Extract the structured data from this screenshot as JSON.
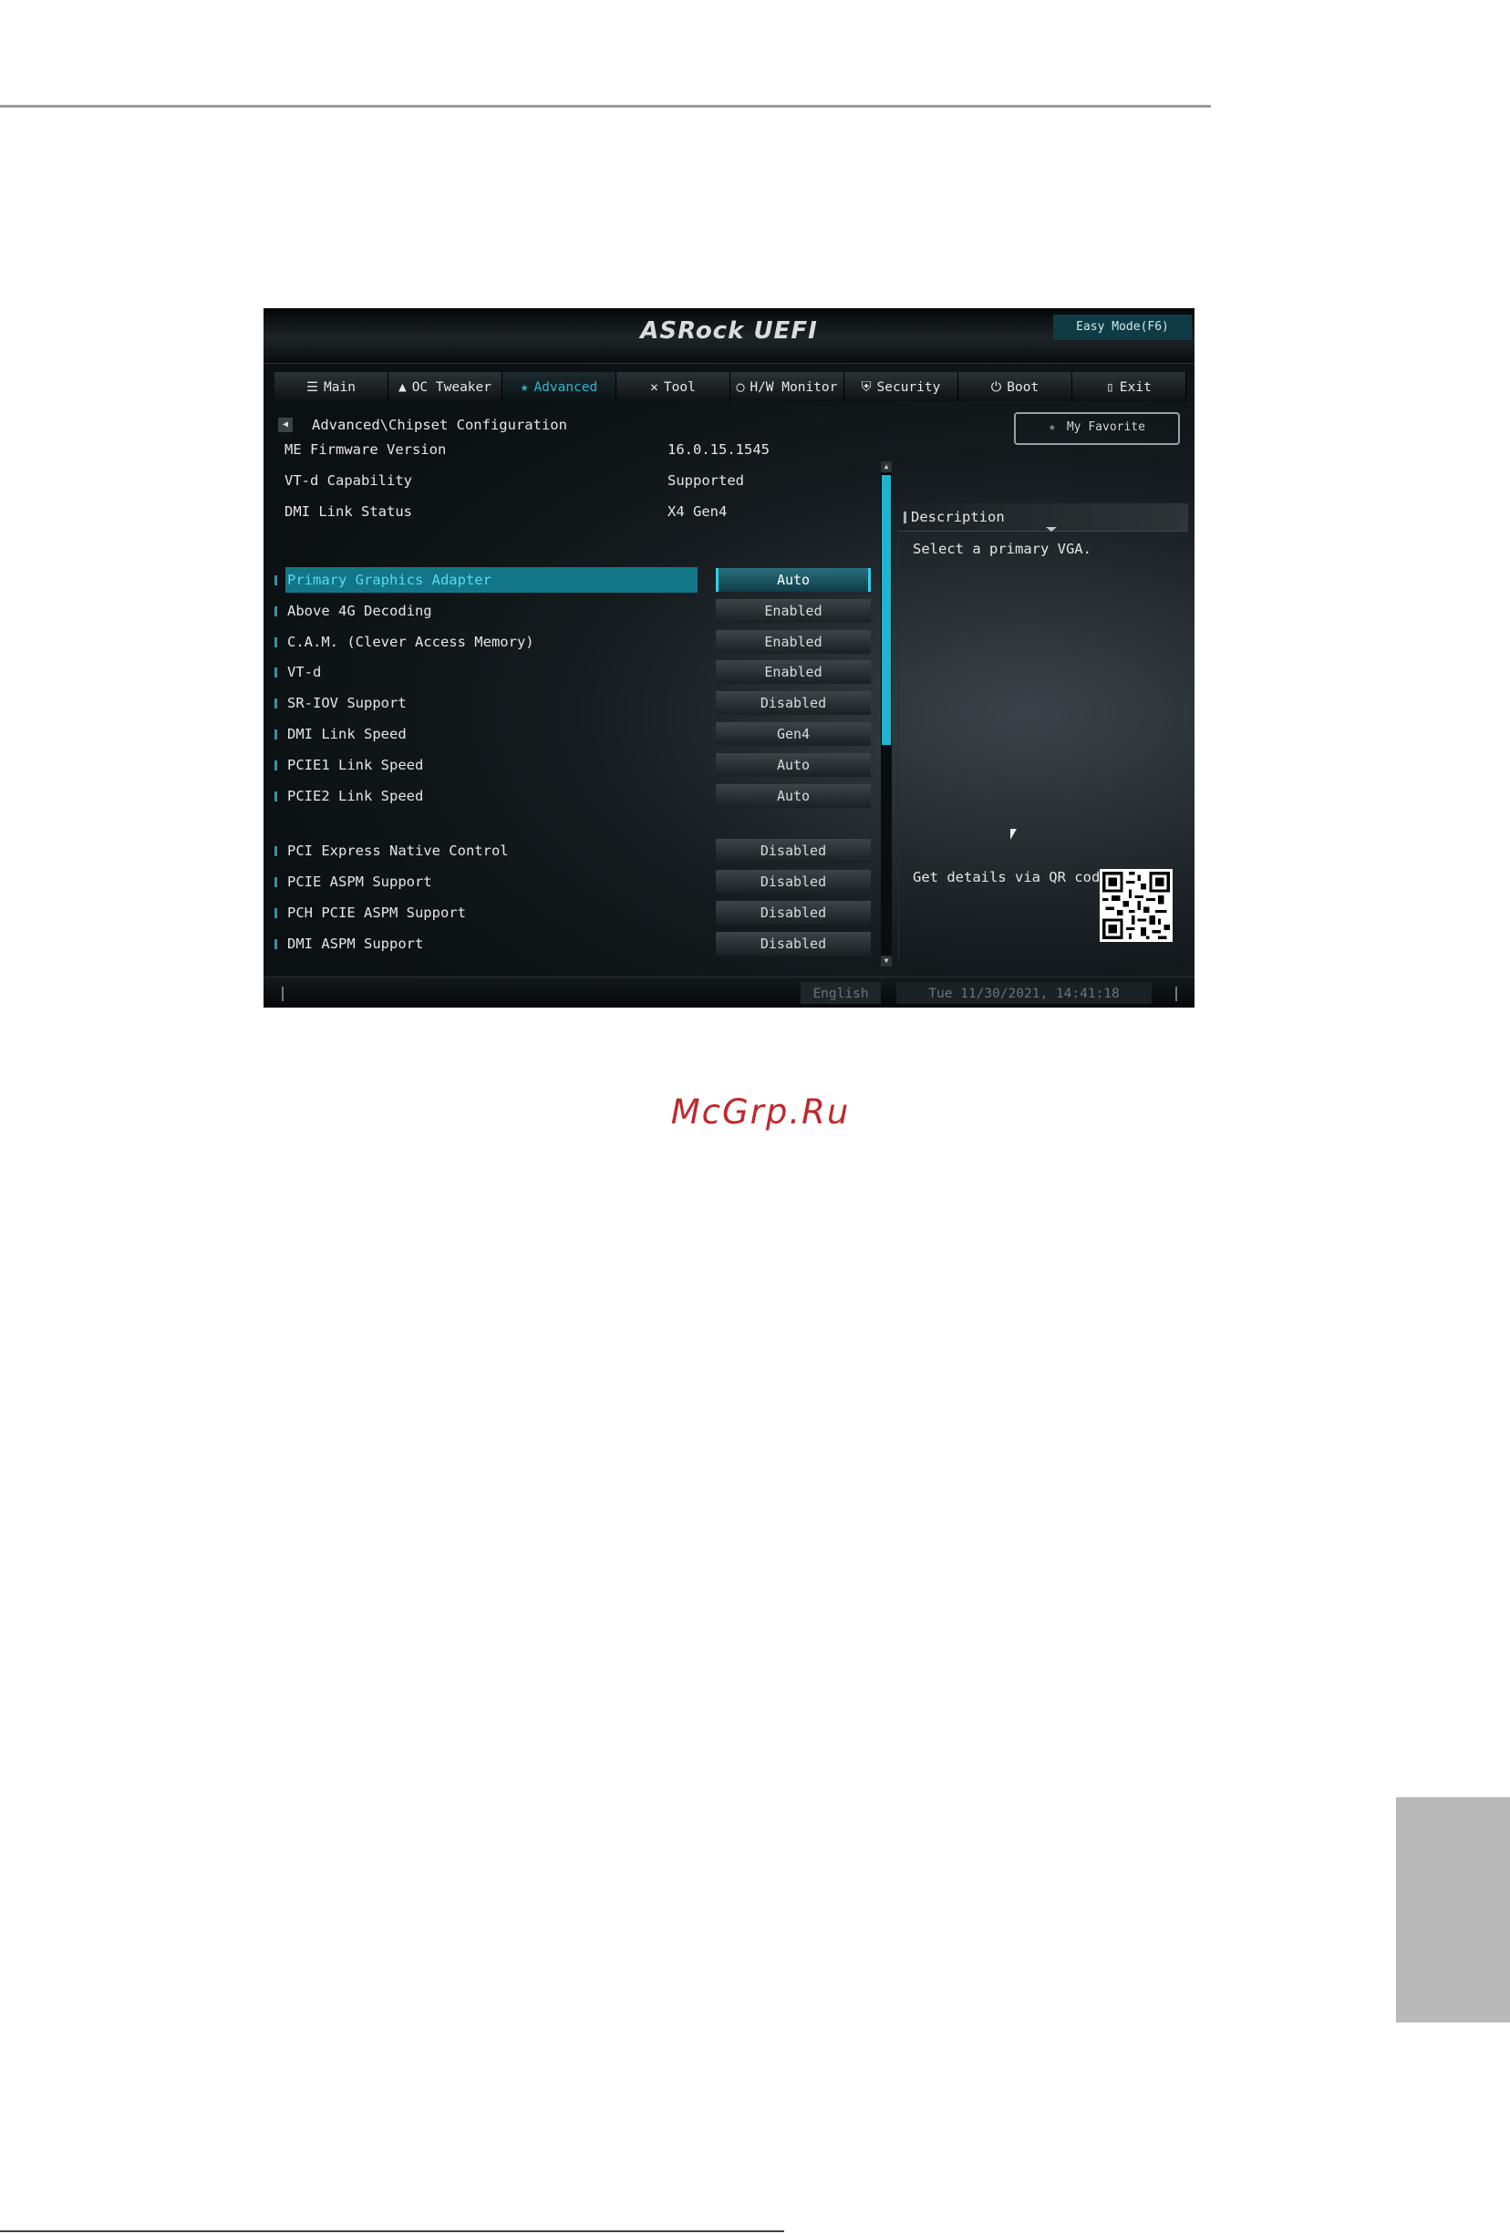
{
  "page": {
    "watermark": "McGrp.Ru"
  },
  "uefi": {
    "logo": "ASRock UEFI",
    "easy_mode": "Easy Mode(F6)",
    "tabs": [
      {
        "label": "Main",
        "icon": "list-icon",
        "glyph": "☰",
        "active": false
      },
      {
        "label": "OC Tweaker",
        "icon": "rocket-icon",
        "glyph": "▲",
        "active": false
      },
      {
        "label": "Advanced",
        "icon": "star-icon",
        "glyph": "★",
        "active": true
      },
      {
        "label": "Tool",
        "icon": "tools-icon",
        "glyph": "✕",
        "active": false
      },
      {
        "label": "H/W Monitor",
        "icon": "monitor-icon",
        "glyph": "◯",
        "active": false
      },
      {
        "label": "Security",
        "icon": "shield-icon",
        "glyph": "⛨",
        "active": false
      },
      {
        "label": "Boot",
        "icon": "power-icon",
        "glyph": "⏻",
        "active": false
      },
      {
        "label": "Exit",
        "icon": "exit-icon",
        "glyph": "▯",
        "active": false
      }
    ],
    "breadcrumb": "Advanced\\Chipset Configuration",
    "my_favorite": "My Favorite",
    "info": [
      {
        "label": "ME Firmware Version",
        "value": "16.0.15.1545"
      },
      {
        "label": "VT-d Capability",
        "value": "Supported"
      },
      {
        "label": "DMI Link Status",
        "value": "X4  Gen4"
      }
    ],
    "options": [
      {
        "label": "Primary Graphics Adapter",
        "value": "Auto",
        "selected": true
      },
      {
        "label": "Above 4G Decoding",
        "value": "Enabled",
        "selected": false
      },
      {
        "label": "C.A.M. (Clever Access Memory)",
        "value": "Enabled",
        "selected": false
      },
      {
        "label": "VT-d",
        "value": "Enabled",
        "selected": false
      },
      {
        "label": "SR-IOV Support",
        "value": "Disabled",
        "selected": false
      },
      {
        "label": "DMI Link Speed",
        "value": "Gen4",
        "selected": false
      },
      {
        "label": "PCIE1 Link Speed",
        "value": "Auto",
        "selected": false
      },
      {
        "label": "PCIE2 Link Speed",
        "value": "Auto",
        "selected": false
      },
      {
        "label": "PCI Express Native Control",
        "value": "Disabled",
        "selected": false
      },
      {
        "label": "PCIE ASPM Support",
        "value": "Disabled",
        "selected": false
      },
      {
        "label": "PCH PCIE ASPM Support",
        "value": "Disabled",
        "selected": false
      },
      {
        "label": "DMI ASPM Support",
        "value": "Disabled",
        "selected": false
      }
    ],
    "description": {
      "title": "Description",
      "text": "Select a primary VGA.",
      "qr_label": "Get details via QR code"
    },
    "status": {
      "language": "English",
      "datetime": "Tue 11/30/2021, 14:41:18"
    },
    "colors": {
      "accent": "#20b4cf",
      "selected_row": "#137688",
      "background": "#0d1214"
    }
  }
}
